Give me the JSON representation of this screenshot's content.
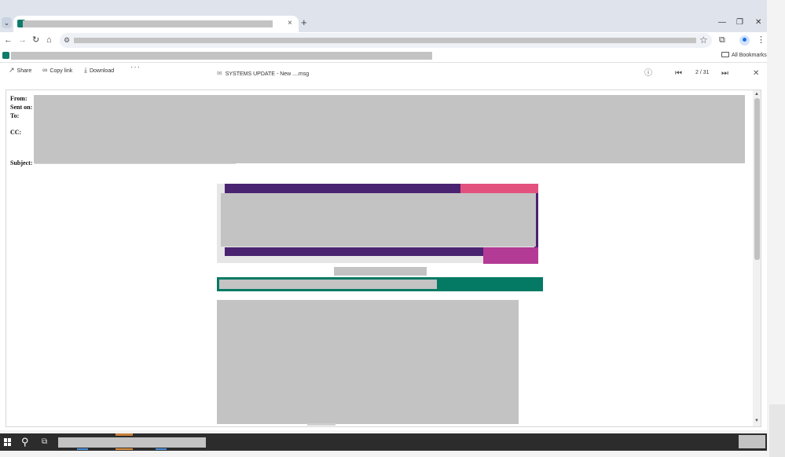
{
  "browser": {
    "tabs": [
      {
        "title": ""
      }
    ],
    "new_tab_symbol": "+",
    "tab_close_symbol": "×",
    "window_controls": {
      "minimize": "—",
      "restore": "❐",
      "close": "✕"
    },
    "nav": {
      "back": "←",
      "forward": "→",
      "reload": "↻",
      "home": "⌂"
    },
    "url": "",
    "bookmarks_bar": {
      "all_bookmarks_label": "All Bookmarks"
    }
  },
  "viewer": {
    "actions": [
      {
        "label": "Share",
        "icon": "share-icon"
      },
      {
        "label": "Copy link",
        "icon": "link-icon"
      },
      {
        "label": "Download",
        "icon": "download-icon"
      }
    ],
    "more_label": "···",
    "document_title": "SYSTEMS UPDATE - New ....msg",
    "page_indicator": "2 / 31"
  },
  "email": {
    "header_labels": {
      "from": "From:",
      "sent_on": "Sent on:",
      "to": "To:",
      "cc": "CC:",
      "subject": "Subject:"
    }
  },
  "colors": {
    "banner_purple": "#4a2371",
    "banner_pink": "#e3517f",
    "banner_magenta": "#b33a95",
    "green_bar": "#047a64",
    "taskbar": "#2c2c2c"
  }
}
